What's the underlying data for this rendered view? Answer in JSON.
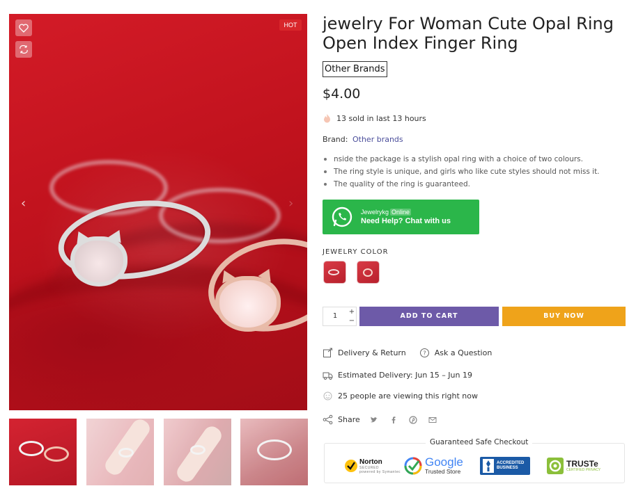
{
  "gallery": {
    "badge": "HOT",
    "thumbnails": [
      "thumb-1",
      "thumb-2",
      "thumb-3",
      "thumb-4"
    ]
  },
  "product": {
    "title": "jewelry For Woman Cute Opal Ring Open Index Finger Ring",
    "brand_box": "Other Brands",
    "price": "$4.00",
    "sold": "13 sold in last 13 hours",
    "brand_label": "Brand:",
    "brand_value": "Other brands",
    "features": [
      "nside the package is a stylish opal ring with a choice of two colours.",
      "The ring style is unique, and girls who like cute styles should not miss it.",
      "The quality of the ring is guaranteed."
    ]
  },
  "whatsapp": {
    "name": "Jewelrykg",
    "status": "Online",
    "cta": "Need Help? Chat with us",
    "color": "#2bb64a"
  },
  "variants": {
    "label": "JEWELRY COLOR",
    "swatches": [
      "silver",
      "rose-gold"
    ]
  },
  "cart": {
    "quantity": "1",
    "plus": "+",
    "minus": "−",
    "add_to_cart": "ADD TO CART",
    "buy_now": "BUY NOW",
    "add_color": "#6d5aa8",
    "buy_color": "#efa31a"
  },
  "info": {
    "delivery_return": "Delivery & Return",
    "ask_question": "Ask a Question",
    "estimated_delivery": "Estimated Delivery: Jun 15 – Jun 19",
    "viewing": "25 people are viewing this right now",
    "share": "Share"
  },
  "checkout": {
    "title": "Guaranteed Safe Checkout",
    "norton": "Norton",
    "norton_secured": "SECURED",
    "norton_powered": "powered by Symantec",
    "google": "Google",
    "google_sub": "Trusted Store",
    "bbb_line1": "ACCREDITED",
    "bbb_line2": "BUSINESS",
    "bbb_mark": "BBB",
    "truste": "TRUSTe",
    "truste_sub": "CERTIFIED PRIVACY"
  }
}
